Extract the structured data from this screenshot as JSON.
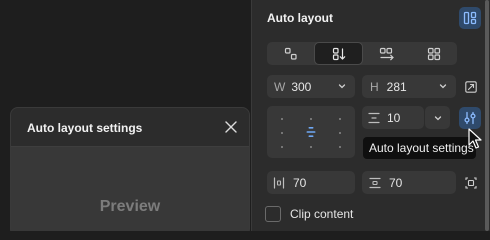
{
  "panel": {
    "title": "Auto layout",
    "width_prefix": "W",
    "width_value": "300",
    "height_prefix": "H",
    "height_value": "281",
    "gap_value": "10",
    "padding_horizontal": "70",
    "padding_vertical": "70",
    "clip_content_label": "Clip content"
  },
  "tooltip": {
    "text": "Auto layout settings"
  },
  "modal": {
    "title": "Auto layout settings",
    "preview_label": "Preview"
  },
  "colors": {
    "accent": "#6fa8f5",
    "panel_bg": "#2c2c2c",
    "field_bg": "#383838",
    "canvas_bg": "#1e1e1e"
  }
}
